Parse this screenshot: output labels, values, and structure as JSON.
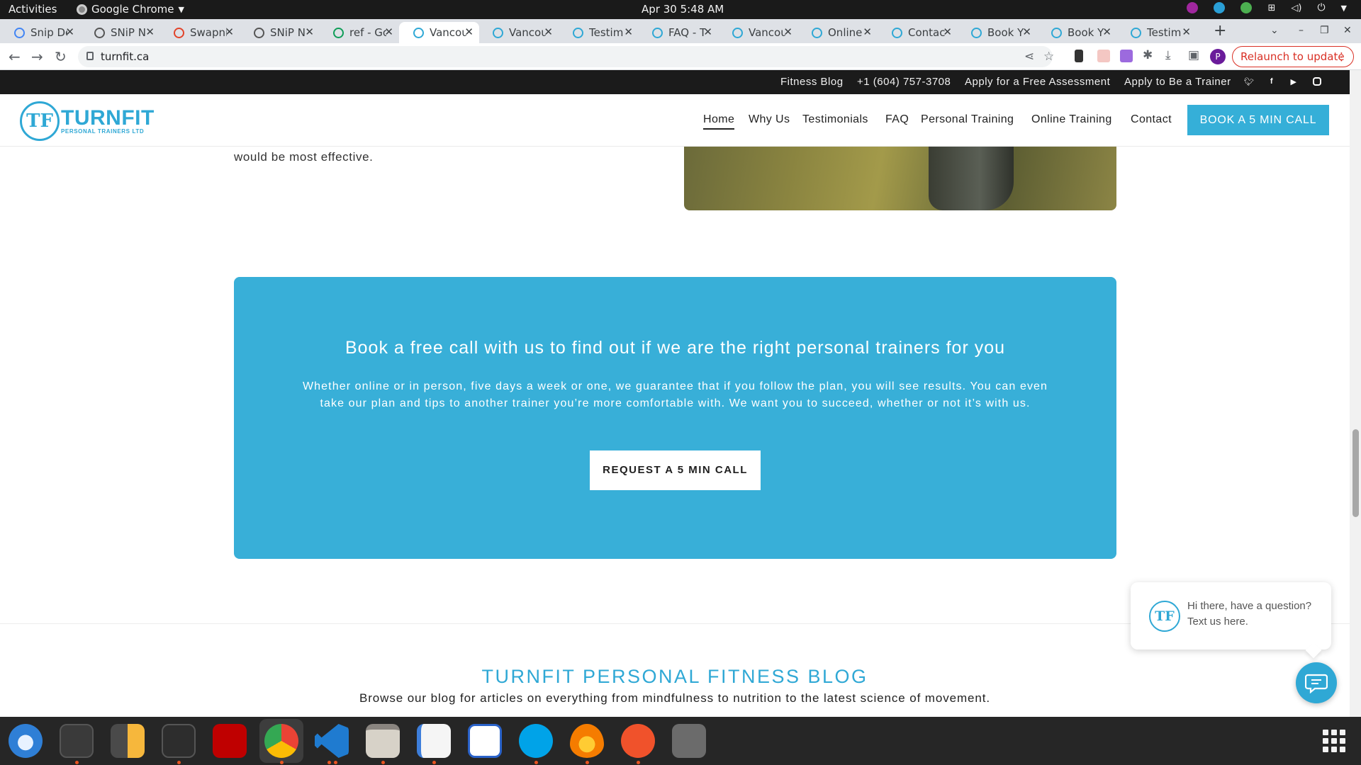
{
  "system": {
    "activities": "Activities",
    "app_name": "Google Chrome",
    "clock": "Apr 30  5:48 AM"
  },
  "browser": {
    "tabs": [
      {
        "label": "Snip De",
        "icon": "docs-icon",
        "color": "#4285f4"
      },
      {
        "label": "SNiP N",
        "icon": "snip-icon",
        "color": "#555555"
      },
      {
        "label": "Swapni",
        "icon": "gitlab-icon",
        "color": "#e24329"
      },
      {
        "label": "SNiP N",
        "icon": "snip-icon",
        "color": "#555555"
      },
      {
        "label": "ref - Go",
        "icon": "sheets-icon",
        "color": "#0f9d58"
      },
      {
        "label": "Vancou",
        "icon": "turnfit-icon",
        "color": "#2fa8d5"
      },
      {
        "label": "Vancou",
        "icon": "turnfit-icon",
        "color": "#2fa8d5"
      },
      {
        "label": "Testim",
        "icon": "turnfit-icon",
        "color": "#2fa8d5"
      },
      {
        "label": "FAQ - T",
        "icon": "turnfit-icon",
        "color": "#2fa8d5"
      },
      {
        "label": "Vancou",
        "icon": "turnfit-icon",
        "color": "#2fa8d5"
      },
      {
        "label": "Online",
        "icon": "turnfit-icon",
        "color": "#2fa8d5"
      },
      {
        "label": "Contac",
        "icon": "turnfit-icon",
        "color": "#2fa8d5"
      },
      {
        "label": "Book Y",
        "icon": "turnfit-icon",
        "color": "#2fa8d5"
      },
      {
        "label": "Book Y",
        "icon": "turnfit-icon",
        "color": "#2fa8d5"
      },
      {
        "label": "Testim",
        "icon": "turnfit-icon",
        "color": "#2fa8d5"
      }
    ],
    "active_tab_index": 5,
    "url": "turnfit.ca",
    "profile_initial": "P",
    "relaunch_label": "Relaunch to update"
  },
  "site": {
    "topbar": {
      "blog": "Fitness Blog",
      "phone": "+1 (604) 757-3708",
      "assessment": "Apply for a Free Assessment",
      "trainer": "Apply to Be a Trainer"
    },
    "logo": {
      "mark": "TF",
      "name": "TURNFIT",
      "sub": "PERSONAL TRAINERS LTD"
    },
    "nav": {
      "home": "Home",
      "why": "Why Us",
      "testimonials": "Testimonials",
      "faq": "FAQ",
      "personal": "Personal Training",
      "online": "Online Training",
      "contact": "Contact",
      "cta": "BOOK A 5 MIN CALL"
    },
    "prev_text": "would be most effective.",
    "cta": {
      "title": "Book a free call with us to find out if we are the right personal trainers for you",
      "body": "Whether online or in person, five days a week or one, we guarantee that if you follow the plan, you will see results. You can even take our plan and tips to another trainer you’re more comfortable with. We want you to succeed, whether or not it’s with us.",
      "button": "REQUEST A 5 MIN CALL"
    },
    "blog": {
      "title": "TURNFIT PERSONAL FITNESS BLOG",
      "subtitle": "Browse our blog for articles on everything from mindfulness to nutrition to the latest science of movement."
    },
    "chat": {
      "mark": "TF",
      "message": "Hi there, have a question? Text us here."
    }
  },
  "colors": {
    "brand": "#2fa8d5",
    "cta_background": "#38afd8",
    "topbar": "#1b1b1b"
  }
}
